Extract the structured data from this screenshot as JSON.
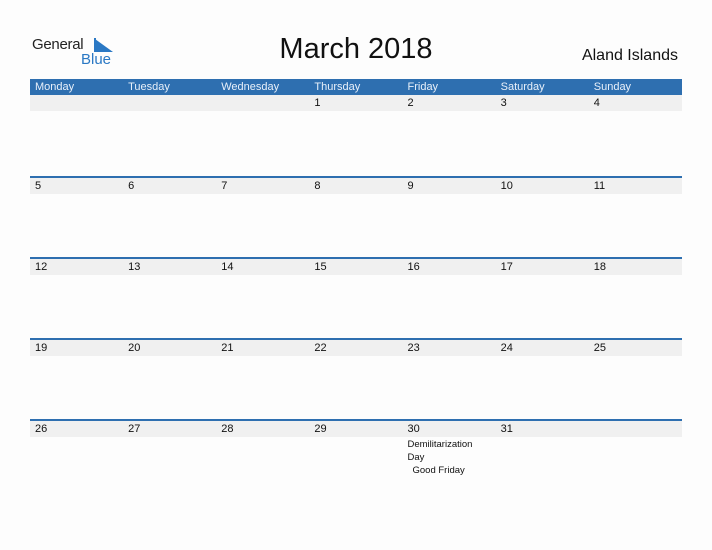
{
  "logo": {
    "line1": "General",
    "line2": "Blue"
  },
  "header": {
    "title": "March 2018",
    "country": "Aland Islands"
  },
  "colors": {
    "accent": "#2e6fb0",
    "band": "#f0f0f0",
    "logo_blue": "#2a78c4"
  },
  "weekdays": [
    "Monday",
    "Tuesday",
    "Wednesday",
    "Thursday",
    "Friday",
    "Saturday",
    "Sunday"
  ],
  "weeks": [
    {
      "days": [
        "",
        "",
        "",
        "1",
        "2",
        "3",
        "4"
      ]
    },
    {
      "days": [
        "5",
        "6",
        "7",
        "8",
        "9",
        "10",
        "11"
      ]
    },
    {
      "days": [
        "12",
        "13",
        "14",
        "15",
        "16",
        "17",
        "18"
      ]
    },
    {
      "days": [
        "19",
        "20",
        "21",
        "22",
        "23",
        "24",
        "25"
      ]
    },
    {
      "days": [
        "26",
        "27",
        "28",
        "29",
        "30",
        "31",
        ""
      ]
    }
  ],
  "events": {
    "30": [
      "Demilitarization Day",
      "Good Friday"
    ]
  }
}
